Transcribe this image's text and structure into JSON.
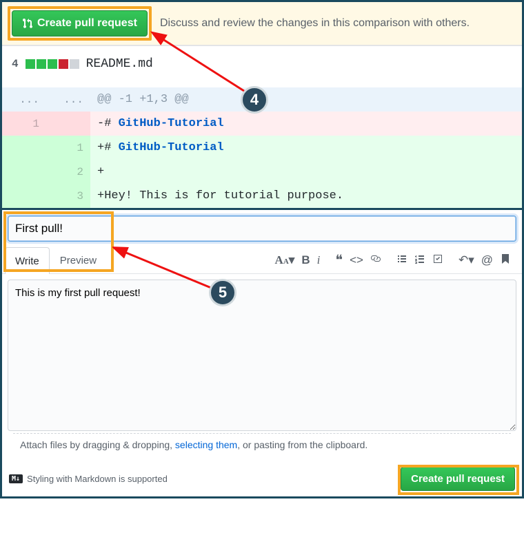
{
  "banner": {
    "create_button_label": "Create pull request",
    "description": "Discuss and review the changes in this comparison with others."
  },
  "diff": {
    "change_count": "4",
    "filename": "README.md",
    "stat_squares": [
      "green",
      "green",
      "green",
      "red",
      "grey"
    ],
    "hunk_header": "@@ -1 +1,3 @@",
    "rows": [
      {
        "type": "del",
        "old": "1",
        "new": "",
        "prefix": "-",
        "marker": "# ",
        "blue": "GitHub-Tutorial",
        "rest": ""
      },
      {
        "type": "add",
        "old": "",
        "new": "1",
        "prefix": "+",
        "marker": "# ",
        "blue": "GitHub-Tutorial",
        "rest": ""
      },
      {
        "type": "add",
        "old": "",
        "new": "2",
        "prefix": "+",
        "marker": "",
        "blue": "",
        "rest": ""
      },
      {
        "type": "add",
        "old": "",
        "new": "3",
        "prefix": "+",
        "marker": "",
        "blue": "",
        "rest": "Hey! This is for tutorial purpose."
      }
    ]
  },
  "form": {
    "title_value": "First pull!",
    "tabs": {
      "write": "Write",
      "preview": "Preview",
      "active": "write"
    },
    "body_value": "This is my first pull request!",
    "attach_prefix": "Attach files by dragging & dropping, ",
    "attach_link": "selecting them",
    "attach_suffix": ", or pasting from the clipboard.",
    "markdown_badge": "M↓",
    "markdown_text": "Styling with Markdown is supported",
    "submit_label": "Create pull request"
  },
  "toolbar_icons": [
    "text-size",
    "bold",
    "italic",
    "quote",
    "code",
    "link",
    "bulleted-list",
    "numbered-list",
    "task-list",
    "reply",
    "mention",
    "bookmark"
  ],
  "annotations": {
    "step4": "4",
    "step5": "5"
  }
}
